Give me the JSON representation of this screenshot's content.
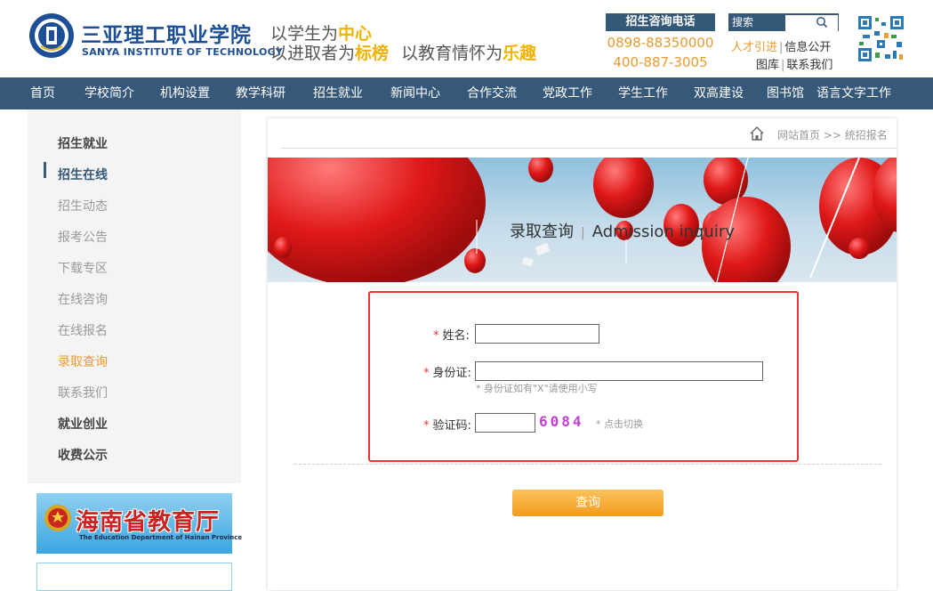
{
  "header": {
    "school_name_cn": "三亚理工职业学院",
    "school_name_en": "SANYA INSTITUTE OF TECHNOLOGY",
    "motto_line1": {
      "a": "以学生为",
      "b": "中心"
    },
    "motto_line2": {
      "a": "以进取者为",
      "b": "标榜",
      "c": "以教育情怀为",
      "d": "乐趣"
    },
    "hotline_label": "招生咨询电话",
    "phone1": "0898-88350000",
    "phone2": "400-887-3005",
    "search_label": "搜索",
    "links": {
      "talent": "人才引进",
      "info": "信息公开",
      "library": "图库",
      "contact": "联系我们"
    },
    "accent_color": "#f0b400",
    "link_accent_color": "#e89a30"
  },
  "nav": {
    "items": [
      "首页",
      "学校简介",
      "机构设置",
      "教学科研",
      "招生就业",
      "新闻中心",
      "合作交流",
      "党政工作",
      "学生工作",
      "双高建设",
      "图书馆",
      "语言文字工作"
    ],
    "bg_color": "#365879"
  },
  "sidebar": {
    "items": [
      "招生就业",
      "招生在线",
      "招生动态",
      "报考公告",
      "下载专区",
      "在线咨询",
      "在线报名",
      "录取查询",
      "联系我们",
      "就业创业",
      "收费公示"
    ],
    "edu_banner": {
      "cn": "海南省教育厅",
      "en": "The Education Department of Hainan Province"
    }
  },
  "breadcrumb": {
    "home": "网站首页",
    "sep": ">>",
    "current": "统招报名"
  },
  "banner": {
    "title_cn": "录取查询",
    "title_en": "Admission inquiry"
  },
  "form": {
    "required_mark": "*",
    "name_label": "姓名:",
    "id_label": "身份证:",
    "id_hint": "* 身份证如有\"X\"请使用小写",
    "captcha_label": "验证码:",
    "captcha_text": "6084",
    "captcha_hint": "* 点击切换",
    "name_value": "",
    "id_value": "",
    "captcha_value": ""
  },
  "submit_label": "查询"
}
